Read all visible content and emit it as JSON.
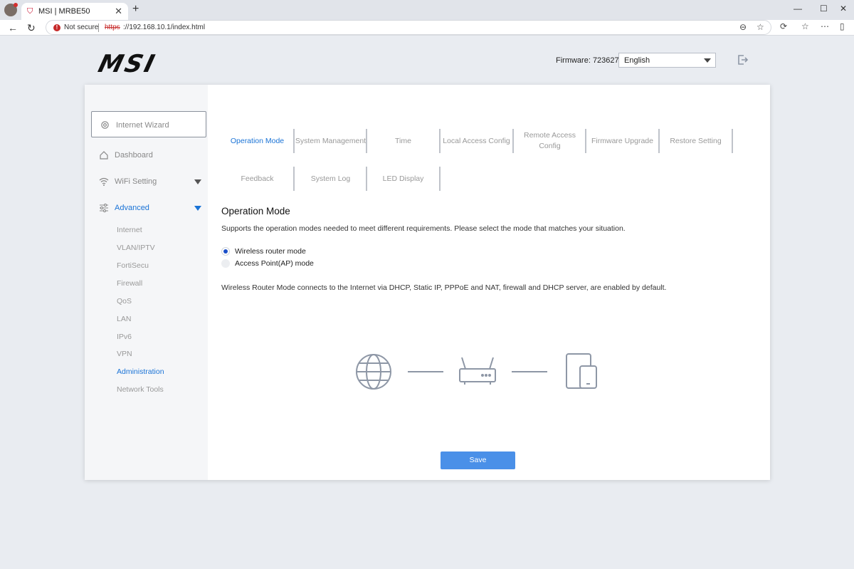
{
  "browser": {
    "tab_title": "MSI | MRBE50",
    "new_tab": "+",
    "close": "✕",
    "minimize": "—",
    "maximize": "☐",
    "window_close": "✕",
    "not_secure": "Not secure",
    "url_scheme": "https",
    "url_rest": "://192.168.10.1/index.html"
  },
  "header": {
    "logo": "MSI",
    "firmware": "Firmware: 723627",
    "language": "English"
  },
  "sidebar": {
    "wizard": "Internet Wizard",
    "items": [
      {
        "label": "Dashboard",
        "icon": "home-icon"
      },
      {
        "label": "WiFi Setting",
        "icon": "wifi-icon"
      },
      {
        "label": "Advanced",
        "icon": "sliders-icon"
      }
    ],
    "sub_items": [
      "Internet",
      "VLAN/IPTV",
      "FortiSecu",
      "Firewall",
      "QoS",
      "LAN",
      "IPv6",
      "VPN",
      "Administration",
      "Network Tools"
    ],
    "active_sub": "Administration"
  },
  "tabs": [
    "Operation Mode",
    "System Management",
    "Time",
    "Local Access Config",
    "Remote Access Config",
    "Firmware Upgrade",
    "Restore Setting",
    "Feedback",
    "System Log",
    "LED Display"
  ],
  "content": {
    "title": "Operation Mode",
    "description": "Supports the operation modes needed to meet different requirements. Please select the mode that matches your situation.",
    "modes": [
      "Wireless router mode",
      "Access Point(AP) mode"
    ],
    "selected_mode": "Wireless router mode",
    "note": "Wireless Router Mode connects to the Internet via DHCP, Static IP, PPPoE and NAT, firewall and DHCP server, are enabled by default.",
    "save": "Save"
  },
  "colors": {
    "accent": "#1a73d6",
    "save_button": "#4a90e8",
    "radio_selected": "#1a4fc9",
    "diagram_stroke": "#8e97a6"
  }
}
